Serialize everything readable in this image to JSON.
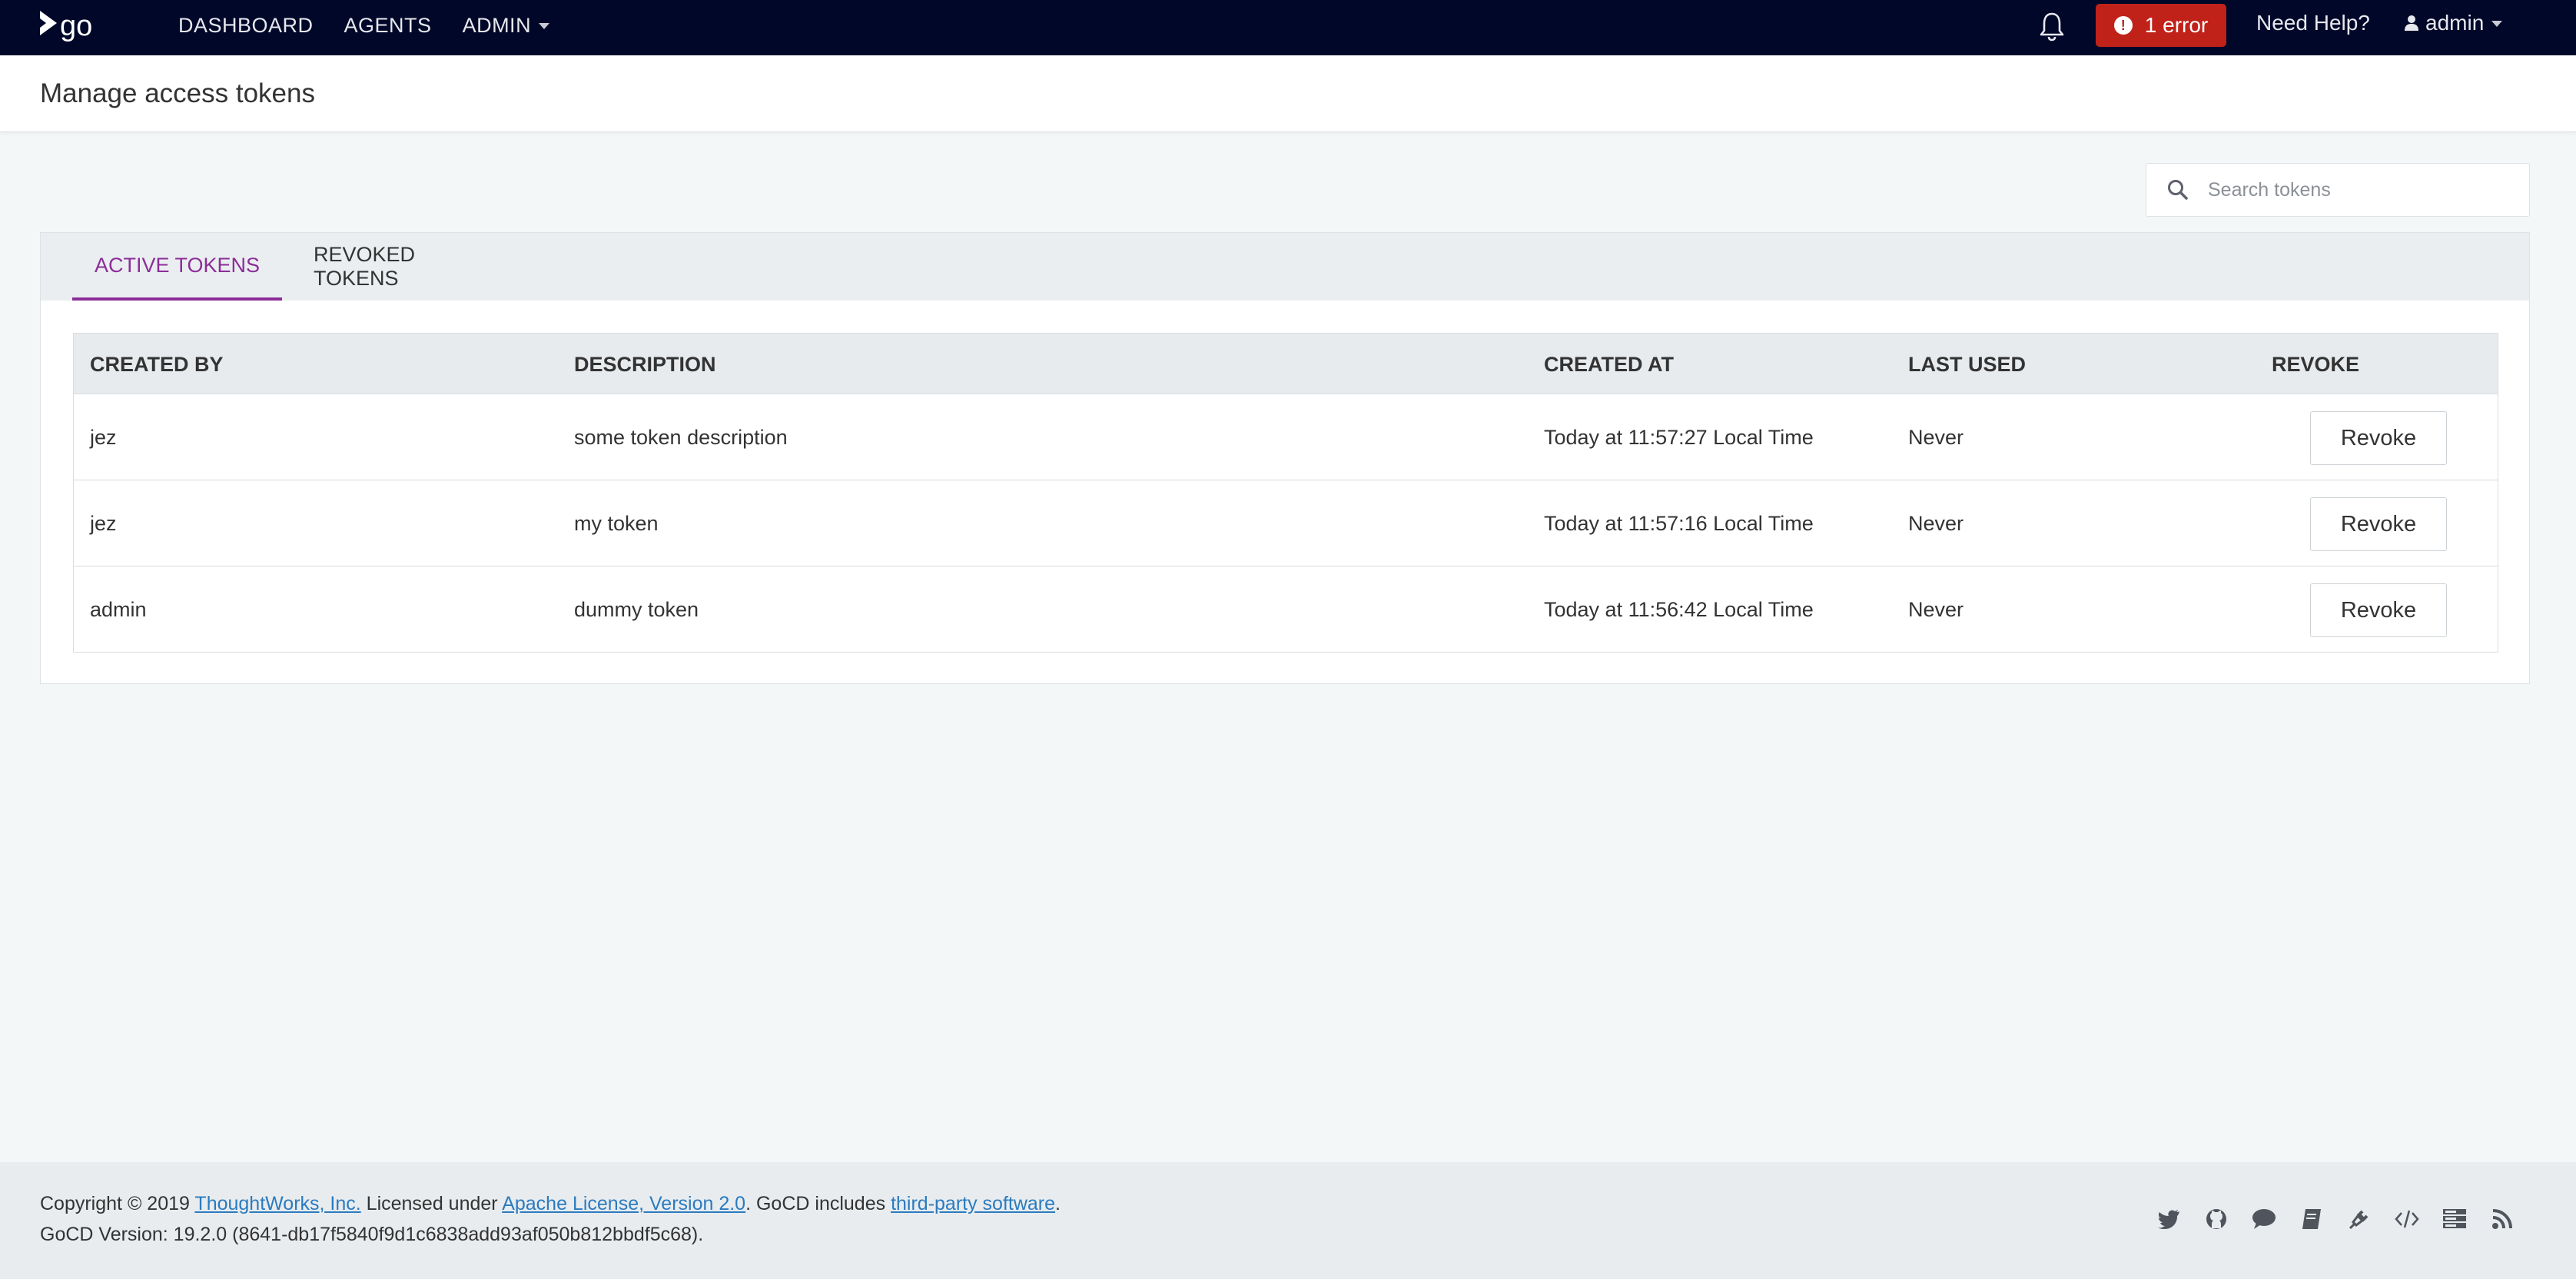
{
  "nav": {
    "links": [
      "DASHBOARD",
      "AGENTS",
      "ADMIN"
    ],
    "error_label": "1 error",
    "help_label": "Need Help?",
    "user_label": "admin"
  },
  "page": {
    "title": "Manage access tokens"
  },
  "search": {
    "placeholder": "Search tokens"
  },
  "tabs": [
    "ACTIVE TOKENS",
    "REVOKED TOKENS"
  ],
  "table": {
    "headers": [
      "CREATED BY",
      "DESCRIPTION",
      "CREATED AT",
      "LAST USED",
      "REVOKE"
    ],
    "rows": [
      {
        "created_by": "jez",
        "description": "some token description",
        "created_at": "Today at 11:57:27 Local Time",
        "last_used": "Never",
        "action": "Revoke"
      },
      {
        "created_by": "jez",
        "description": "my token",
        "created_at": "Today at 11:57:16 Local Time",
        "last_used": "Never",
        "action": "Revoke"
      },
      {
        "created_by": "admin",
        "description": "dummy token",
        "created_at": "Today at 11:56:42 Local Time",
        "last_used": "Never",
        "action": "Revoke"
      }
    ]
  },
  "footer": {
    "copyright": "Copyright © 2019 ",
    "company_link": "ThoughtWorks, Inc.",
    "licensed": " Licensed under ",
    "license_link": "Apache License, Version 2.0",
    "includes": ". GoCD includes ",
    "thirdparty_link": "third-party software",
    "end": ".",
    "version": "GoCD Version: 19.2.0 (8641-db17f5840f9d1c6838add93af050b812bbdf5c68)."
  },
  "colors": {
    "nav_bg": "#000728",
    "error": "#c0221a",
    "accent": "#8c2d98",
    "link": "#2b7bbf"
  },
  "icons": [
    "go-logo",
    "bell-icon",
    "error-icon",
    "user-icon",
    "caret-down-icon",
    "search-icon",
    "twitter-icon",
    "github-icon",
    "chat-icon",
    "book-icon",
    "plugin-icon",
    "api-icon",
    "server-icon",
    "rss-icon"
  ]
}
